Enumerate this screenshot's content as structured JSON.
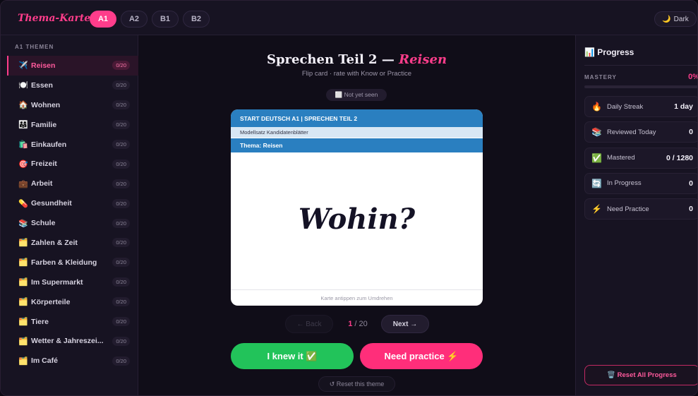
{
  "header": {
    "logo": "Thema-Karten",
    "levels": [
      {
        "label": "A1",
        "active": true
      },
      {
        "label": "A2",
        "active": false
      },
      {
        "label": "B1",
        "active": false
      },
      {
        "label": "B2",
        "active": false
      }
    ],
    "theme_toggle": {
      "icon": "🌙",
      "label": "Dark"
    }
  },
  "sidebar": {
    "title": "A1 THEMEN",
    "topics": [
      {
        "icon": "✈️",
        "label": "Reisen",
        "count": "0/20",
        "active": true
      },
      {
        "icon": "🍽️",
        "label": "Essen",
        "count": "0/20"
      },
      {
        "icon": "🏠",
        "label": "Wohnen",
        "count": "0/20"
      },
      {
        "icon": "👨‍👩‍👧",
        "label": "Familie",
        "count": "0/20"
      },
      {
        "icon": "🛍️",
        "label": "Einkaufen",
        "count": "0/20"
      },
      {
        "icon": "🎯",
        "label": "Freizeit",
        "count": "0/20"
      },
      {
        "icon": "💼",
        "label": "Arbeit",
        "count": "0/20"
      },
      {
        "icon": "💊",
        "label": "Gesundheit",
        "count": "0/20"
      },
      {
        "icon": "📚",
        "label": "Schule",
        "count": "0/20"
      },
      {
        "icon": "🗂️",
        "label": "Zahlen & Zeit",
        "count": "0/20"
      },
      {
        "icon": "🗂️",
        "label": "Farben & Kleidung",
        "count": "0/20"
      },
      {
        "icon": "🗂️",
        "label": "Im Supermarkt",
        "count": "0/20"
      },
      {
        "icon": "🗂️",
        "label": "Körperteile",
        "count": "0/20"
      },
      {
        "icon": "🗂️",
        "label": "Tiere",
        "count": "0/20"
      },
      {
        "icon": "🗂️",
        "label": "Wetter & Jahreszei...",
        "count": "0/20"
      },
      {
        "icon": "🗂️",
        "label": "Im Café",
        "count": "0/20"
      }
    ]
  },
  "main": {
    "title_prefix": "Sprechen Teil 2 — ",
    "title_accent": "Reisen",
    "subtitle": "Flip card · rate with Know or Practice",
    "status": "⬜ Not yet seen",
    "card": {
      "header": "START DEUTSCH A1 | SPRECHEN TEIL 2",
      "subheader": "Modellsatz Kandidatenblätter",
      "theme": "Thema: Reisen",
      "word": "Wohin?",
      "hint": "Karte antippen zum Umdrehen"
    },
    "nav": {
      "back": "← Back",
      "current": "1",
      "total": "/ 20",
      "next": "Next →"
    },
    "knew_button": "I knew it ✅",
    "practice_button": "Need practice ⚡",
    "reset_theme": "↺ Reset this theme"
  },
  "panel": {
    "title": "📊 Progress",
    "mastery_label": "MASTERY",
    "mastery_value": "0%",
    "mastery_fraction": 0,
    "stats": [
      {
        "icon": "🔥",
        "label": "Daily Streak",
        "value": "1 day"
      },
      {
        "icon": "📚",
        "label": "Reviewed Today",
        "value": "0"
      },
      {
        "icon": "✅",
        "label": "Mastered",
        "value": "0 / 1280"
      },
      {
        "icon": "🔄",
        "label": "In Progress",
        "value": "0"
      },
      {
        "icon": "⚡",
        "label": "Need Practice",
        "value": "0"
      }
    ],
    "reset_all": "🗑️ Reset All Progress"
  },
  "colors": {
    "accent": "#ff3d8b",
    "success": "#22c35a",
    "card_blue": "#2a7fc0"
  }
}
